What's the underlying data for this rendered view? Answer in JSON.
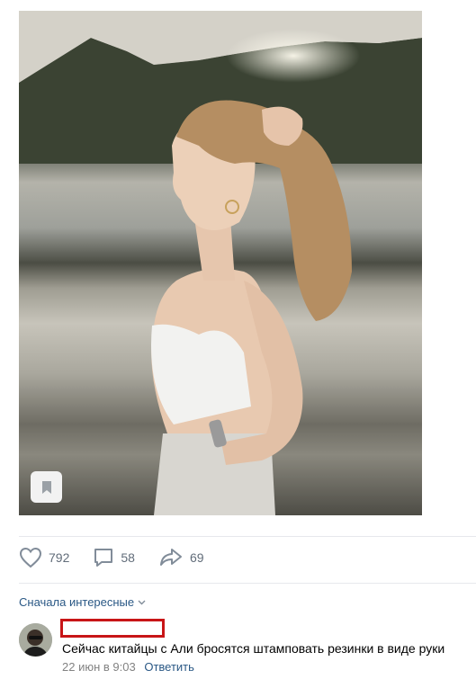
{
  "post": {
    "photo_alt": "Photo",
    "likes": "792",
    "comments": "58",
    "shares": "69"
  },
  "comments_section": {
    "sort_label": "Сначала интересные"
  },
  "comment": {
    "author": "",
    "text": "Сейчас китайцы с Али бросятся штамповать резинки в виде руки",
    "date": "22 июн в 9:03",
    "reply_label": "Ответить"
  },
  "colors": {
    "link": "#2a5885",
    "muted": "#828282",
    "icon": "#818c99",
    "redaction": "#c81517"
  }
}
